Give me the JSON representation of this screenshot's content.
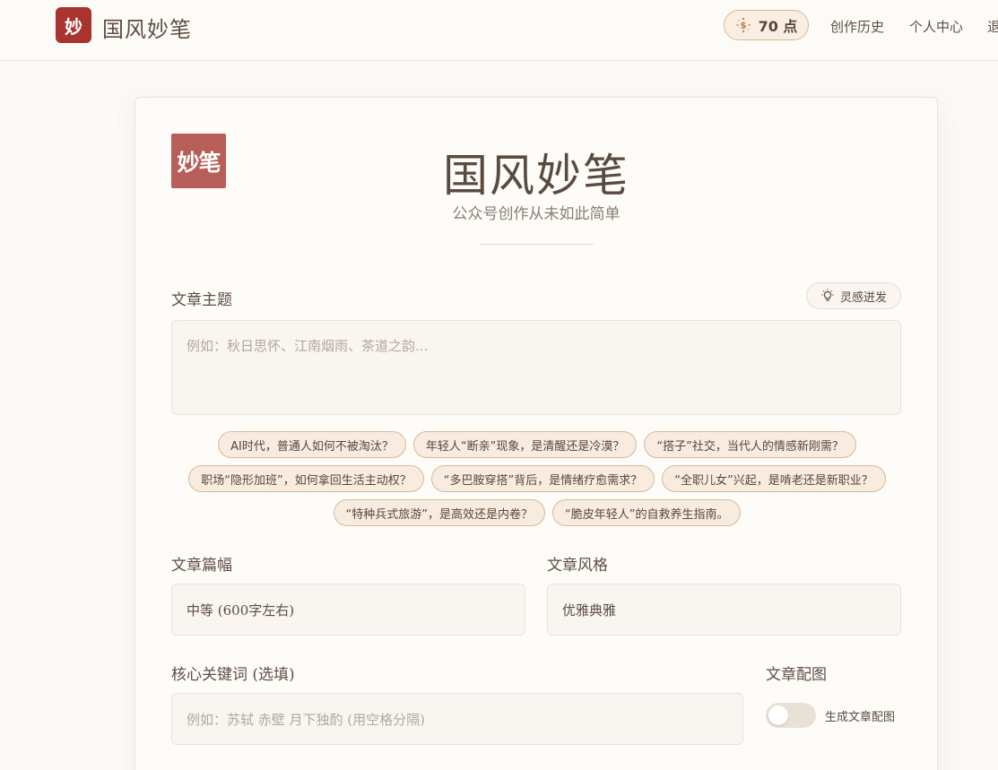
{
  "header": {
    "logo_char": "妙",
    "title": "国风妙笔",
    "points": "70 点",
    "nav": [
      "创作历史",
      "个人中心",
      "退出"
    ]
  },
  "card": {
    "seal_text": "妙笔",
    "title": "国风妙笔",
    "subtitle": "公众号创作从未如此简单"
  },
  "topic": {
    "label": "文章主题",
    "inspire_button": "灵感迸发",
    "placeholder": "例如：秋日思怀、江南烟雨、茶道之韵..."
  },
  "suggestions": [
    [
      "AI时代，普通人如何不被淘汰？",
      "年轻人“断亲”现象，是清醒还是冷漠？",
      "“搭子”社交，当代人的情感新刚需？"
    ],
    [
      "职场“隐形加班”，如何拿回生活主动权？",
      "“多巴胺穿搭”背后，是情绪疗愈需求？",
      "“全职儿女”兴起，是啃老还是新职业？"
    ],
    [
      "“特种兵式旅游”，是高效还是内卷？",
      "“脆皮年轻人”的自救养生指南。"
    ]
  ],
  "length": {
    "label": "文章篇幅",
    "value": "中等 (600字左右)"
  },
  "style": {
    "label": "文章风格",
    "value": "优雅典雅"
  },
  "keywords": {
    "label": "核心关键词 (选填)",
    "placeholder": "例如：苏轼 赤壁 月下独酌 (用空格分隔)"
  },
  "image": {
    "label": "文章配图",
    "toggle_label": "生成文章配图",
    "enabled": false
  },
  "colors": {
    "brand": "#a8332f",
    "seal": "#b75e58",
    "chip_bg": "#f8ebdf",
    "chip_border": "#d9b998"
  }
}
